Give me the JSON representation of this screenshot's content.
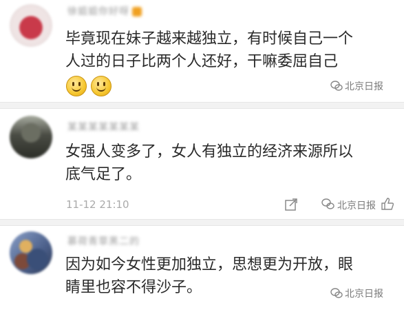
{
  "comments": [
    {
      "username": "徐姐姐你好呀",
      "text_lines": [
        "毕竟现在妹子越来越独立，有时候自己一个",
        "人过的日子比两个人还好，干嘛委屈自己"
      ],
      "emoji_count": 2,
      "watermark": "北京日报"
    },
    {
      "username": "某某某某某某某",
      "text_lines": [
        "女强人变多了，女人有独立的经济来源所以",
        "底气足了。"
      ],
      "timestamp": "11-12 21:10",
      "watermark": "北京日报"
    },
    {
      "username": "慕荷青草黑二的",
      "text_lines": [
        "因为如今女性更加独立，思想更为开放，眼",
        "睛里也容不得沙子。"
      ],
      "watermark": "北京日报"
    }
  ],
  "colors": {
    "text": "#2a2a2a",
    "meta": "#aaaaaa",
    "divider": "#f2f2f2"
  }
}
